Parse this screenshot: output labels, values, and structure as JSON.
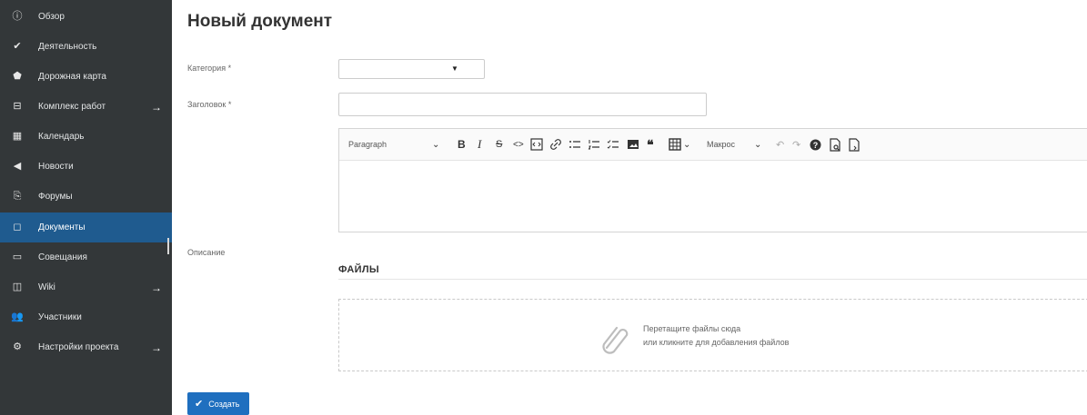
{
  "sidebar": {
    "items": [
      {
        "label": "Обзор",
        "icon": "info-icon",
        "glyph": "ⓘ",
        "arrow": ""
      },
      {
        "label": "Деятельность",
        "icon": "check-icon",
        "glyph": "✔",
        "arrow": ""
      },
      {
        "label": "Дорожная карта",
        "icon": "roadmap-icon",
        "glyph": "⬟",
        "arrow": ""
      },
      {
        "label": "Комплекс работ",
        "icon": "work-package-icon",
        "glyph": "⊟",
        "arrow": "→"
      },
      {
        "label": "Календарь",
        "icon": "calendar-icon",
        "glyph": "▦",
        "arrow": ""
      },
      {
        "label": "Новости",
        "icon": "news-icon",
        "glyph": "◀",
        "arrow": ""
      },
      {
        "label": "Форумы",
        "icon": "forum-icon",
        "glyph": "⎘",
        "arrow": ""
      },
      {
        "label": "Документы",
        "icon": "document-icon",
        "glyph": "◻",
        "arrow": ""
      },
      {
        "label": "Совещания",
        "icon": "meeting-icon",
        "glyph": "▭",
        "arrow": ""
      },
      {
        "label": "Wiki",
        "icon": "wiki-icon",
        "glyph": "◫",
        "arrow": "→"
      },
      {
        "label": "Участники",
        "icon": "members-icon",
        "glyph": "👥",
        "arrow": ""
      },
      {
        "label": "Настройки проекта",
        "icon": "settings-icon",
        "glyph": "⚙",
        "arrow": "→"
      }
    ],
    "active_index": 7
  },
  "main": {
    "title": "Новый документ",
    "category_label": "Категория *",
    "category_value": "",
    "category_caret": "▼",
    "title_label": "Заголовок *",
    "title_value": "",
    "description_label": "Описание",
    "editor": {
      "paragraph": "Paragraph",
      "paragraph_caret": "⌄",
      "bold": "B",
      "italic": "I",
      "strike": "S",
      "code": "<>",
      "macro": "Макрос",
      "macro_caret": "⌄",
      "table_caret": "⌄"
    },
    "files_heading": "ФАЙЛЫ",
    "dropzone_line1": "Перетащите файлы сюда",
    "dropzone_line2": "или кликните для добавления файлов",
    "create_button": "Создать",
    "create_check": "✔"
  },
  "colors": {
    "sidebar_bg": "#333739",
    "sidebar_active": "#1f5b8f",
    "primary_button": "#1f6fbf"
  }
}
